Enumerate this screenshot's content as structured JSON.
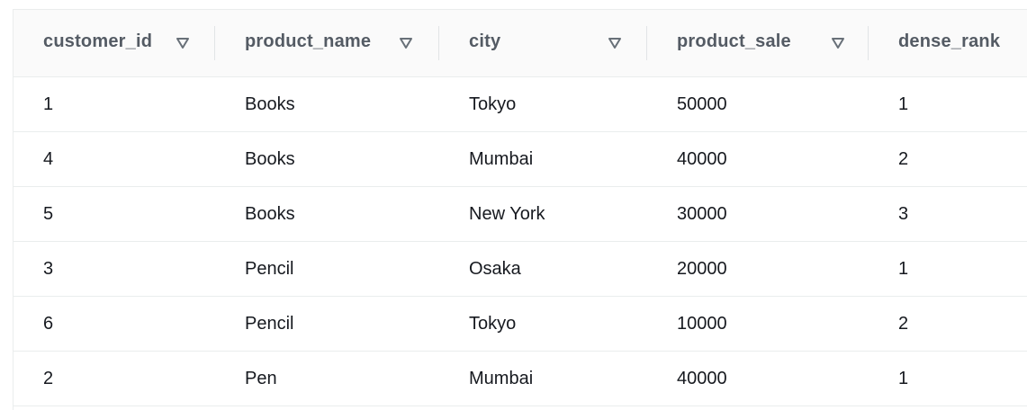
{
  "table": {
    "columns": [
      {
        "label": "customer_id",
        "sort_icon": "triangle-down-outline-icon"
      },
      {
        "label": "product_name",
        "sort_icon": "triangle-down-outline-icon"
      },
      {
        "label": "city",
        "sort_icon": "triangle-down-outline-icon"
      },
      {
        "label": "product_sale",
        "sort_icon": "triangle-down-outline-icon"
      },
      {
        "label": "dense_rank"
      }
    ],
    "rows": [
      [
        "1",
        "Books",
        "Tokyo",
        "50000",
        "1"
      ],
      [
        "4",
        "Books",
        "Mumbai",
        "40000",
        "2"
      ],
      [
        "5",
        "Books",
        "New York",
        "30000",
        "3"
      ],
      [
        "3",
        "Pencil",
        "Osaka",
        "20000",
        "1"
      ],
      [
        "6",
        "Pencil",
        "Tokyo",
        "10000",
        "2"
      ],
      [
        "2",
        "Pen",
        "Mumbai",
        "40000",
        "1"
      ]
    ]
  },
  "colors": {
    "header_background": "#fafafa",
    "header_text": "#545b64",
    "cell_text": "#16191f",
    "divider": "#eaeded",
    "sort_icon": "#687078"
  }
}
